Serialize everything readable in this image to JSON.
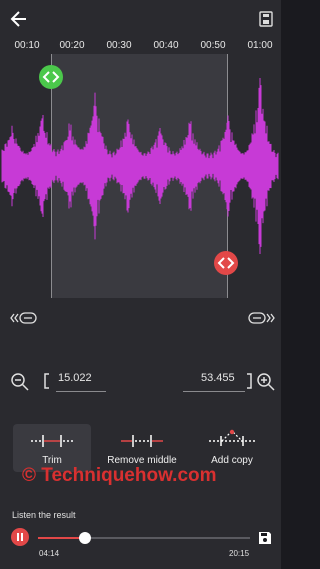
{
  "header": {
    "back_icon": "arrow-left-icon",
    "save_icon": "save-file-icon"
  },
  "ruler": {
    "ticks": [
      "00:10",
      "00:20",
      "00:30",
      "00:40",
      "00:50",
      "01:00"
    ]
  },
  "waveform": {
    "color": "#c73ad6",
    "start_handle_color": "#4bc84b",
    "end_handle_color": "#e24848"
  },
  "zoom": {
    "start_value": "15.022",
    "end_value": "53.455"
  },
  "modes": {
    "trim_label": "Trim",
    "remove_middle_label": "Remove middle",
    "add_copy_label": "Add copy"
  },
  "watermark": "© Techniquehow.com",
  "player": {
    "listen_label": "Listen the result",
    "current_time": "04:14",
    "total_time": "20:15",
    "progress_percent": 22,
    "accent_color": "#e24848"
  }
}
